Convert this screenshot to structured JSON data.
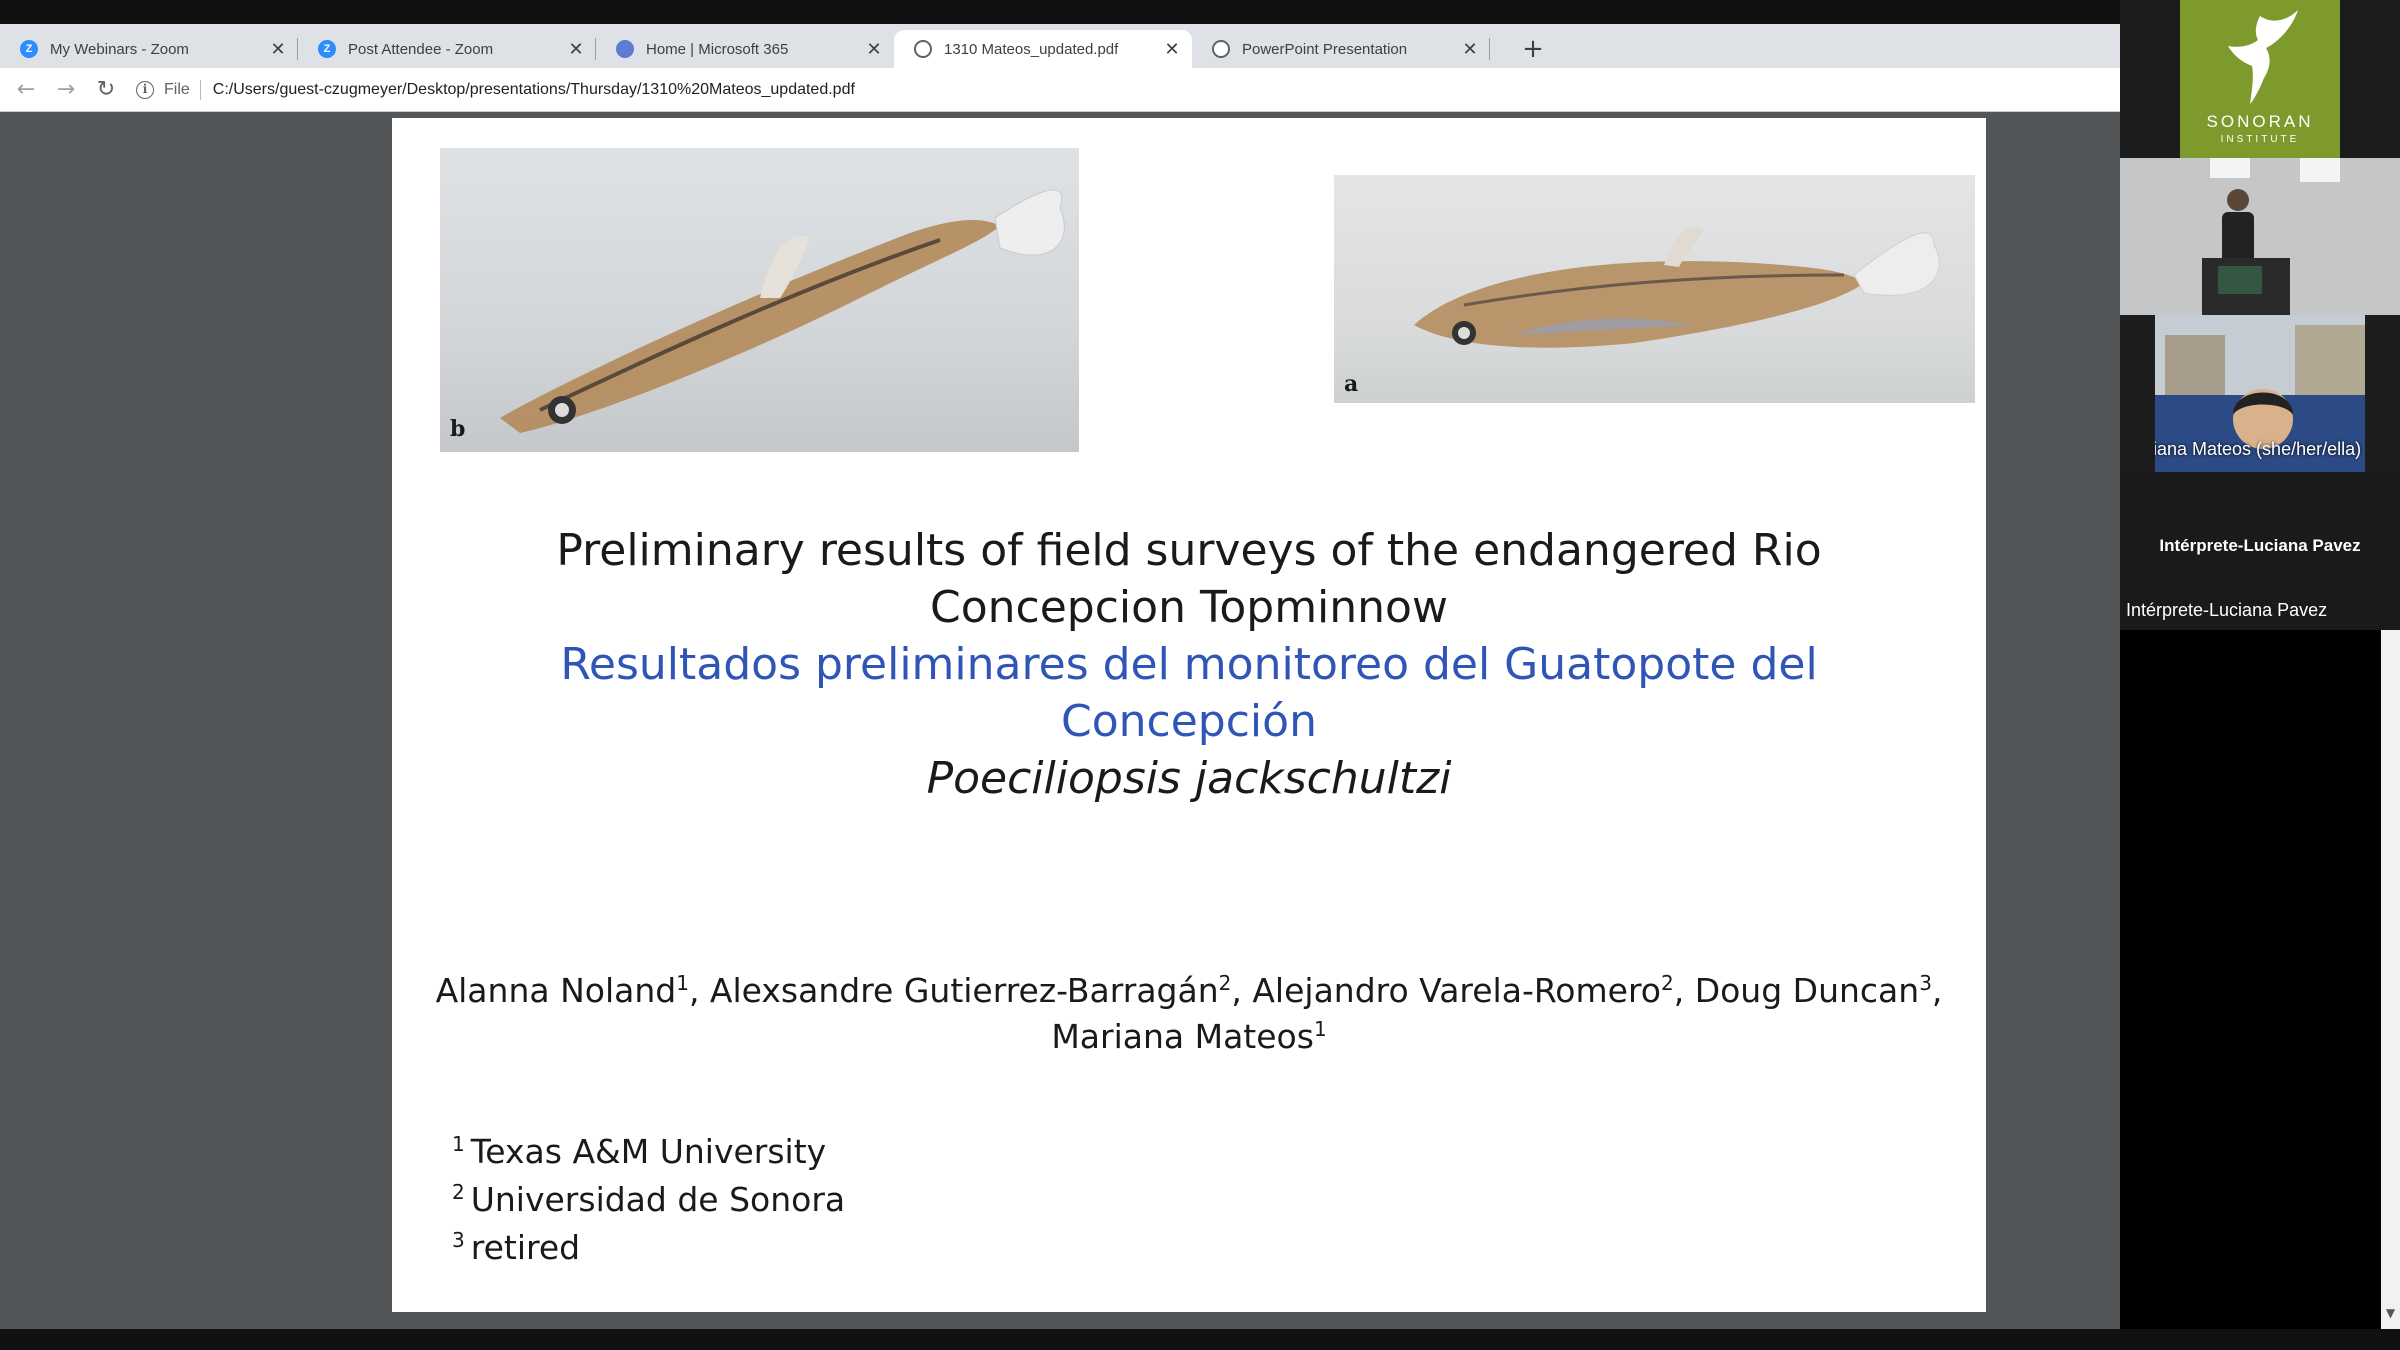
{
  "browser": {
    "tabs": [
      {
        "title": "My Webinars - Zoom",
        "icon": "zoom-icon",
        "active": false
      },
      {
        "title": "Post Attendee - Zoom",
        "icon": "zoom-icon",
        "active": false
      },
      {
        "title": "Home | Microsoft 365",
        "icon": "microsoft-365-icon",
        "active": false
      },
      {
        "title": "1310 Mateos_updated.pdf",
        "icon": "globe-icon",
        "active": true
      },
      {
        "title": "PowerPoint Presentation",
        "icon": "globe-icon",
        "active": false
      }
    ],
    "close_glyph": "✕",
    "new_tab_glyph": "+",
    "nav": {
      "back": "←",
      "forward": "→",
      "reload": "↻"
    },
    "address": {
      "scheme_label": "File",
      "info_glyph": "i",
      "url": "C:/Users/guest-czugmeyer/Desktop/presentations/Thursday/1310%20Mateos_updated.pdf"
    }
  },
  "slide": {
    "photo_labels": {
      "left": "b",
      "right": "a"
    },
    "title_en": [
      "Preliminary results of field surveys of the endangered Rio",
      "Concepcion Topminnow"
    ],
    "title_es": [
      "Resultados preliminares del monitoreo del Guatopote del",
      "Concepción"
    ],
    "species": "Poeciliopsis jackschultzi",
    "authors": [
      {
        "name": "Alanna Noland",
        "sup": "1",
        "after": ", "
      },
      {
        "name": "Alexsandre Gutierrez-Barragán",
        "sup": "2",
        "after": ", "
      },
      {
        "name": "Alejandro Varela-Romero",
        "sup": "2",
        "after": ", "
      },
      {
        "name": "Doug Duncan",
        "sup": "3",
        "after": ","
      },
      {
        "name": "Mariana Mateos",
        "sup": "1",
        "after": ""
      }
    ],
    "affiliations": [
      {
        "sup": "1",
        "name": "Texas A&M University"
      },
      {
        "sup": "2",
        "name": "Universidad de Sonora"
      },
      {
        "sup": "3",
        "name": "retired"
      }
    ]
  },
  "participants": {
    "logo": {
      "name": "SONORAN",
      "sub": "INSTITUTE",
      "icon": "hummingbird-icon"
    },
    "video_2_name": "Mariana Mateos (she/her/ella)",
    "interpreter_center": "Intérprete-Luciana Pavez",
    "interpreter_name": "Intérprete-Luciana Pavez"
  },
  "colors": {
    "title_blue": "#2f55b6",
    "logo_green": "#7f9a2c",
    "viewer_gray": "#525659"
  }
}
